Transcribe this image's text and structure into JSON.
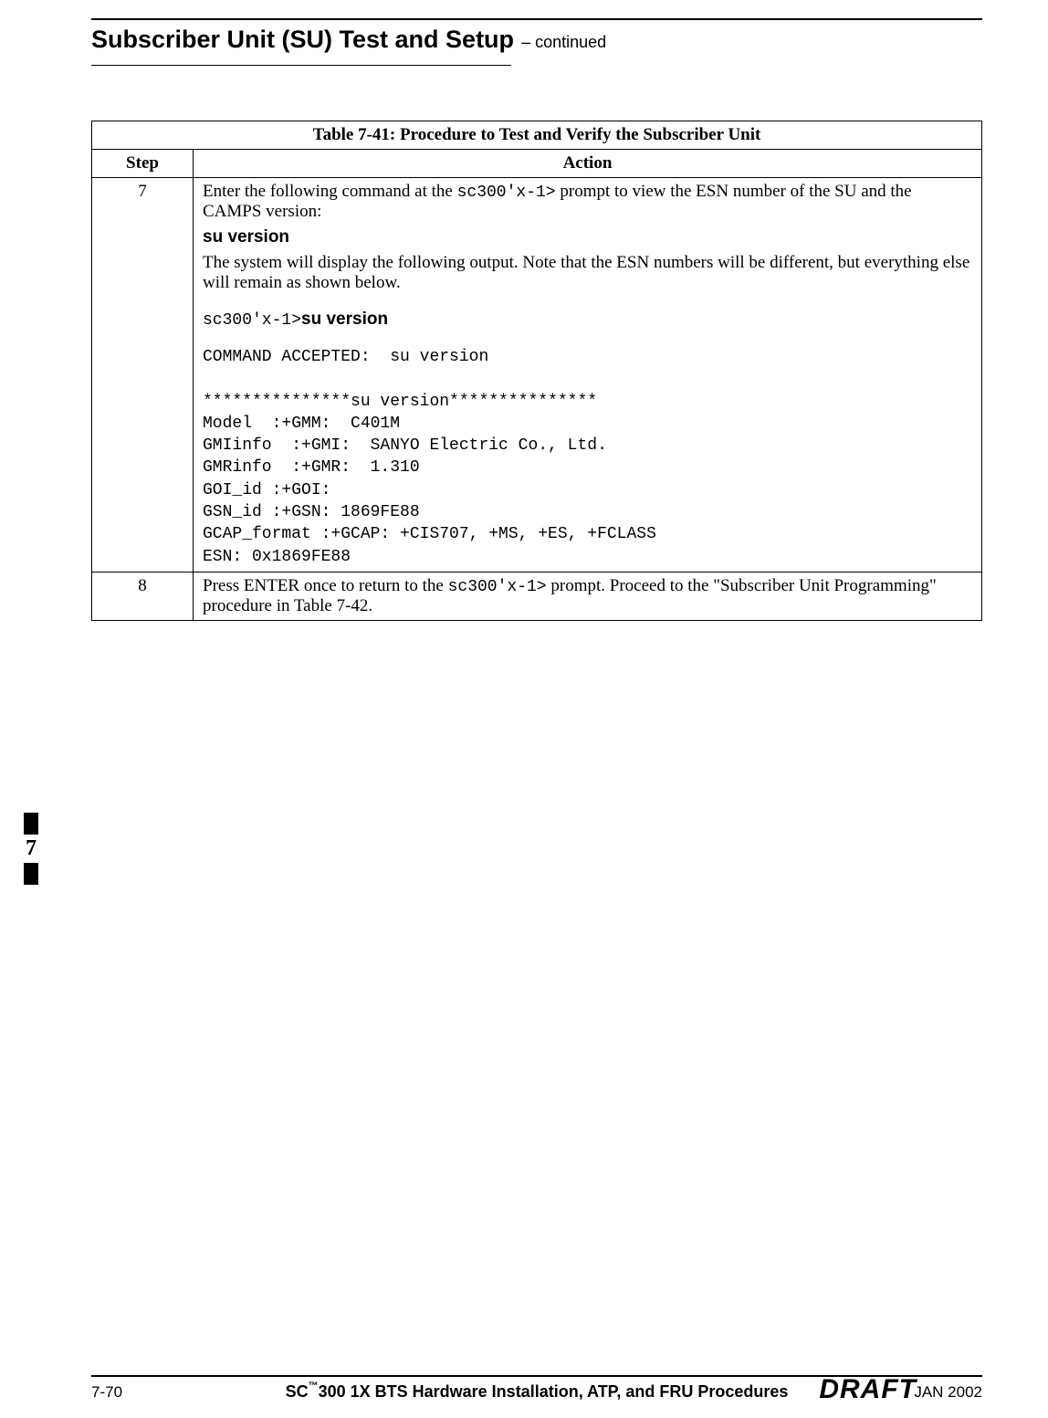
{
  "header": {
    "title_main": "Subscriber Unit (SU) Test and Setup",
    "title_cont": " – continued"
  },
  "table": {
    "caption_label": "Table 7-41:",
    "caption_rest": " Procedure to Test and Verify the Subscriber Unit",
    "col_step": "Step",
    "col_action": "Action",
    "rows": [
      {
        "step": "7",
        "intro_a": "Enter the following command at the ",
        "intro_code": "sc300'x-1>",
        "intro_b": " prompt to view the ESN number of the SU and the CAMPS version:",
        "cmd_label": "su version",
        "note": "The system will display the following output.  Note that the ESN numbers will be different, but everything else will remain as shown below.",
        "prompt_line_prompt": "sc300'x-1>",
        "prompt_line_cmd": "su version",
        "output": "COMMAND ACCEPTED:  su version\n\n***************su version***************\nModel  :+GMM:  C401M\nGMIinfo  :+GMI:  SANYO Electric Co., Ltd.\nGMRinfo  :+GMR:  1.310\nGOI_id :+GOI:\nGSN_id :+GSN: 1869FE88\nGCAP_format :+GCAP: +CIS707, +MS, +ES, +FCLASS\nESN: 0x1869FE88"
      },
      {
        "step": "8",
        "text_a": "Press ENTER once to return to the ",
        "text_code": "sc300'x-1>",
        "text_b": " prompt.  Proceed to the \"Subscriber Unit Programming\" procedure in Table 7-42."
      }
    ]
  },
  "side_tab": "7",
  "footer": {
    "left": "7-70",
    "center_pre": "SC",
    "center_tm": "™",
    "center_post": "300 1X BTS Hardware Installation, ATP, and FRU Procedures",
    "right": "JAN 2002",
    "draft": "DRAFT"
  }
}
